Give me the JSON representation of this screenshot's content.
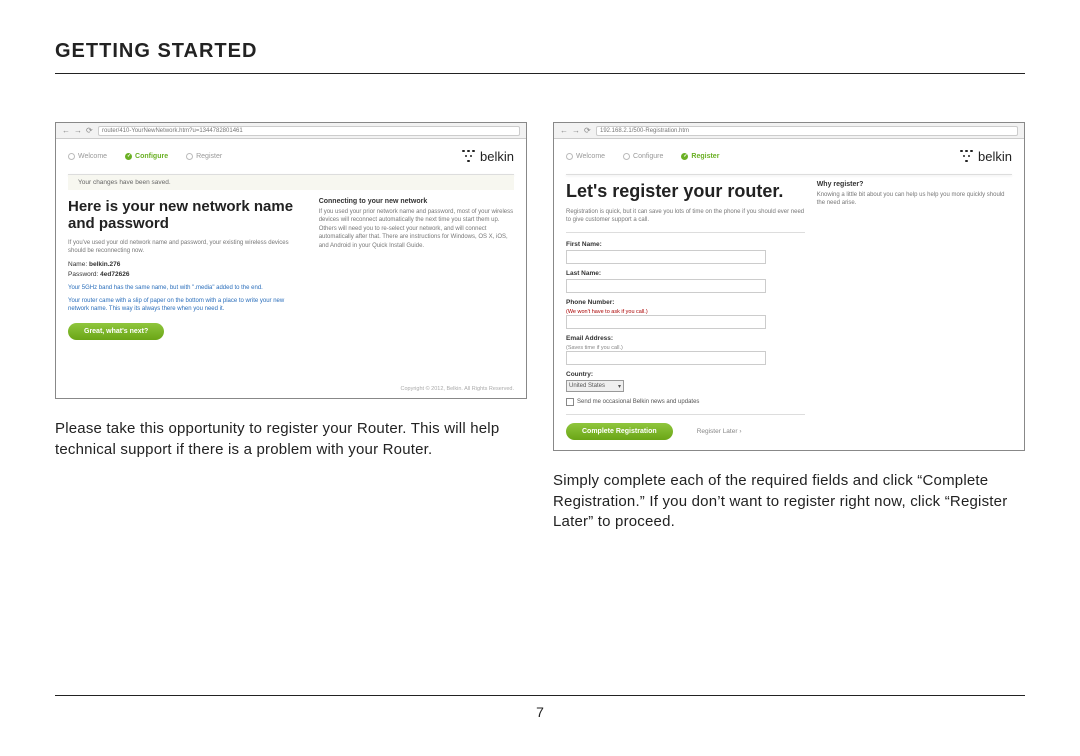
{
  "page": {
    "title": "GETTING STARTED",
    "number": "7"
  },
  "left": {
    "url": "router/410-YourNewNetwork.htm?u=1344782801461",
    "steps": [
      "Welcome",
      "Configure",
      "Register"
    ],
    "active_step_index": 1,
    "brand": "belkin",
    "notice": "Your changes have been saved.",
    "heading": "Here is your new network name and password",
    "subtext": "If you've used your old network name and password, your existing wireless devices should be reconnecting now.",
    "name_label": "Name:",
    "name_value": "belkin.276",
    "password_label": "Password:",
    "password_value": "4ed72626",
    "band_text": "Your 5GHz band has the same name, but with \".media\" added to the end.",
    "reminder_text": "Your router came with a slip of paper on the bottom with a place to write your new network name. This way its always there when you need it.",
    "button": "Great, what's next?",
    "side_heading": "Connecting to your new network",
    "side_text": "If you used your prior network name and password, most of your wireless devices will reconnect automatically the next time you start them up. Others will need you to re-select your network, and will connect automatically after that. There are instructions for Windows, OS X, iOS, and Android in your Quick Install Guide.",
    "copyright": "Copyright © 2012, Belkin. All Rights Reserved.",
    "caption": "Please take this opportunity to register your Router. This will help technical support if there is a problem with your Router."
  },
  "right": {
    "url": "192.168.2.1/500-Registration.htm",
    "steps": [
      "Welcome",
      "Configure",
      "Register"
    ],
    "active_step_index": 2,
    "brand": "belkin",
    "heading": "Let's register your router.",
    "subtext": "Registration is quick, but it can save you lots of time on the phone if you should ever need to give customer support a call.",
    "fields": {
      "first_name": "First Name:",
      "last_name": "Last Name:",
      "phone": "Phone Number:",
      "phone_hint": "(We won't have to ask if you call.)",
      "email": "Email Address:",
      "email_hint": "(Saves time if you call.)",
      "country": "Country:",
      "country_value": "United States"
    },
    "checkbox_label": "Send me occasional Belkin news and updates",
    "submit": "Complete Registration",
    "later": "Register Later ›",
    "side_heading": "Why register?",
    "side_text": "Knowing a little bit about you can help us help you more quickly should the need arise.",
    "caption": "Simply complete each of the required fields and click “Complete Registration.” If you don’t want to register right now, click “Register Later” to proceed."
  }
}
